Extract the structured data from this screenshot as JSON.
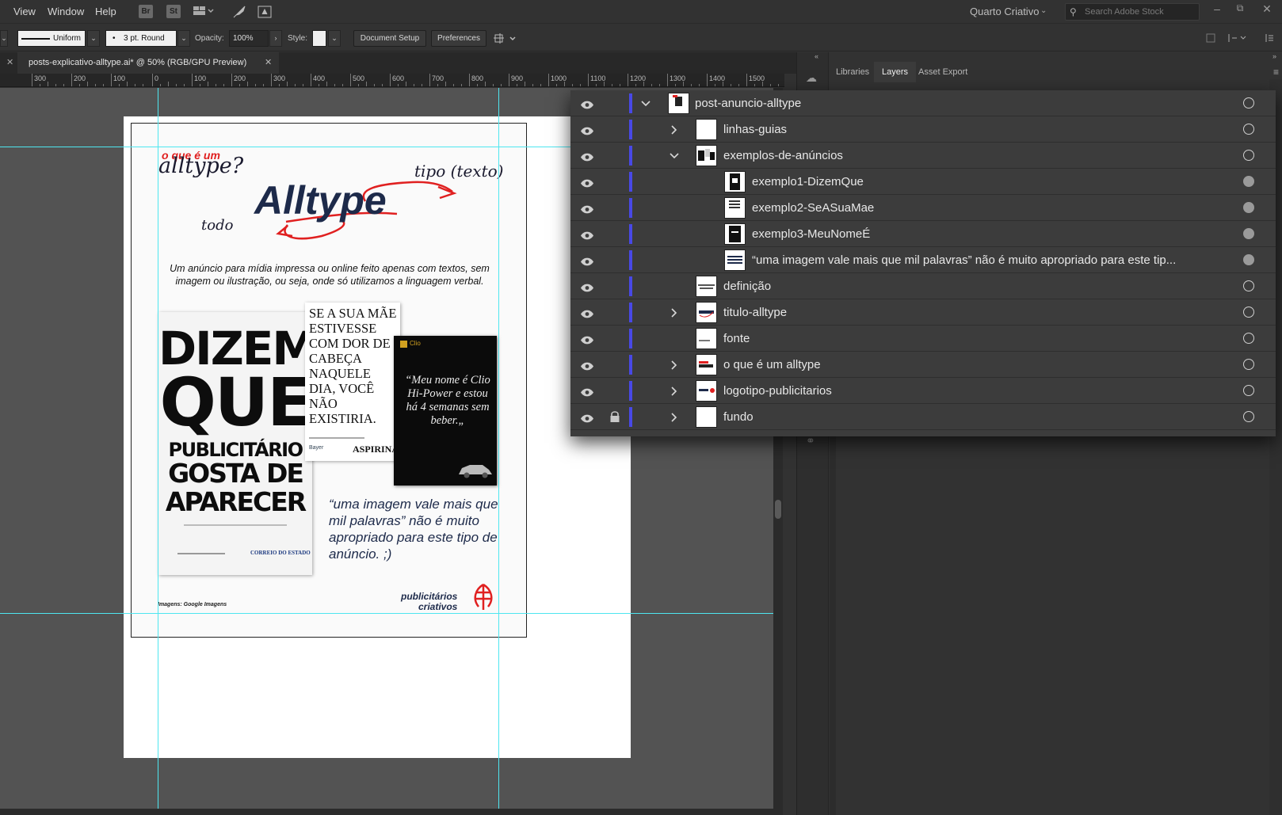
{
  "menubar": {
    "items": [
      "View",
      "Window",
      "Help"
    ],
    "apps": [
      "Br",
      "St"
    ],
    "workspace": "Quarto Criativo",
    "search_placeholder": "Search Adobe Stock"
  },
  "controlbar": {
    "stroke_profile": "Uniform",
    "brush": "3 pt. Round",
    "opacity_label": "Opacity:",
    "opacity_value": "100%",
    "style_label": "Style:",
    "document_setup": "Document Setup",
    "preferences": "Preferences"
  },
  "document": {
    "tab_title": "posts-explicativo-alltype.ai* @ 50% (RGB/GPU Preview)"
  },
  "ruler": {
    "labels": [
      "300",
      "200",
      "100",
      "0",
      "100",
      "200",
      "300",
      "400",
      "500",
      "600",
      "700",
      "800",
      "900",
      "1000",
      "1100",
      "1200",
      "1300",
      "1400",
      "1500"
    ]
  },
  "artwork": {
    "question_red": "o que é um",
    "question_script": "alltype?",
    "logo": "Alltype",
    "label_tipo": "tipo (texto)",
    "label_todo": "todo",
    "definition": "Um anúncio para mídia impressa ou online feito apenas com textos, sem imagem ou ilustração, ou seja, onde só utilizamos a linguagem verbal.",
    "ad1_lines": [
      "DIZEM",
      "QUE",
      "PUBLICITÁRIO",
      "GOSTA DE",
      "APARECER"
    ],
    "ad1_footer": "CORREIO DO ESTADO",
    "ad2_text": "SE A SUA MÃE ESTIVESSE COM DOR DE CABEÇA NAQUELE DIA, VOCÊ NÃO EXISTIRIA.",
    "ad2_brand": "ASPIRINA",
    "ad3_text": "“Meu nome é Clio Hi-Power e estou há 4 semanas sem beber.„",
    "ad3_logo": "Clio",
    "quote": "“uma imagem vale mais que mil palavras” não é muito apropriado para este tipo de anúncio. ;)",
    "credit": "Imagens: Google Imagens",
    "brand_line1": "publicitários",
    "brand_line2": "criativos"
  },
  "panel": {
    "tabs": [
      "Libraries",
      "Layers",
      "Asset Export"
    ],
    "active_tab": "Layers"
  },
  "layers": [
    {
      "name": "post-anuncio-alltype",
      "expanded": true,
      "chevron": "down",
      "level": 0,
      "locked": false,
      "target_filled": false
    },
    {
      "name": "linhas-guias",
      "chevron": "right",
      "level": 1,
      "locked": false,
      "target_filled": false
    },
    {
      "name": "exemplos-de-anúncios",
      "chevron": "down",
      "level": 1,
      "locked": false,
      "target_filled": false
    },
    {
      "name": "exemplo1-DizemQue",
      "chevron": "none",
      "level": 2,
      "locked": false,
      "target_filled": true
    },
    {
      "name": "exemplo2-SeASuaMae",
      "chevron": "none",
      "level": 2,
      "locked": false,
      "target_filled": true
    },
    {
      "name": "exemplo3-MeuNomeÉ",
      "chevron": "none",
      "level": 2,
      "locked": false,
      "target_filled": true
    },
    {
      "name": "“uma imagem vale mais que mil palavras” não é muito apropriado para este tip...",
      "chevron": "none",
      "level": 2,
      "locked": false,
      "target_filled": true
    },
    {
      "name": "definição",
      "chevron": "none",
      "level": 1,
      "locked": false,
      "target_filled": false
    },
    {
      "name": "titulo-alltype",
      "chevron": "right",
      "level": 1,
      "locked": false,
      "target_filled": false
    },
    {
      "name": "fonte",
      "chevron": "none",
      "level": 1,
      "locked": false,
      "target_filled": false
    },
    {
      "name": "o que é um alltype",
      "chevron": "right",
      "level": 1,
      "locked": false,
      "target_filled": false
    },
    {
      "name": "logotipo-publicitarios",
      "chevron": "right",
      "level": 1,
      "locked": false,
      "target_filled": false
    },
    {
      "name": "fundo",
      "chevron": "right",
      "level": 1,
      "locked": true,
      "target_filled": false
    }
  ],
  "colors": {
    "layer_color": "#4848e6",
    "guide": "#4ee6f0",
    "accent_red": "#e02020",
    "navy": "#1d2a4a"
  }
}
